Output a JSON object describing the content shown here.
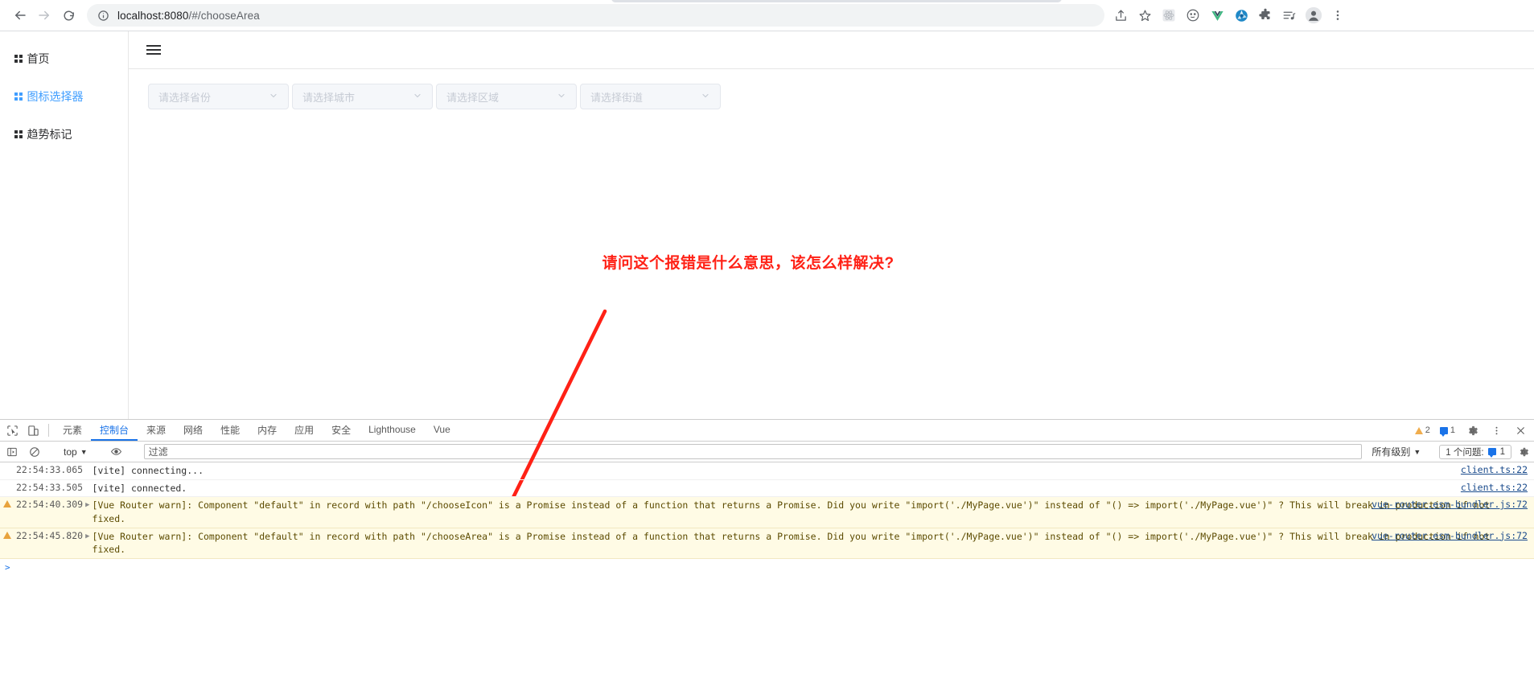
{
  "browser": {
    "back_label": "back-arrow",
    "forward_label": "forward-arrow",
    "reload_label": "reload",
    "url_main": "localhost:8080",
    "url_path": "/#/chooseArea",
    "toolbar_icons": [
      "share-icon",
      "star-icon",
      "react-devtools-icon",
      "emoji-icon",
      "vue-devtools-icon",
      "camera-icon",
      "extensions-icon",
      "playlist-icon",
      "profile-icon",
      "menu-icon"
    ]
  },
  "sidebar": {
    "items": [
      {
        "label": "首页",
        "active": false
      },
      {
        "label": "图标选择器",
        "active": true
      },
      {
        "label": "趋势标记",
        "active": false
      }
    ]
  },
  "main": {
    "selects": [
      {
        "placeholder": "请选择省份"
      },
      {
        "placeholder": "请选择城市"
      },
      {
        "placeholder": "请选择区域"
      },
      {
        "placeholder": "请选择街道"
      }
    ],
    "annotation": "请问这个报错是什么意思，该怎么样解决?",
    "annotation_color": "#ff2116"
  },
  "devtools": {
    "tabs": [
      {
        "label": "元素",
        "active": false
      },
      {
        "label": "控制台",
        "active": true
      },
      {
        "label": "来源",
        "active": false
      },
      {
        "label": "网络",
        "active": false
      },
      {
        "label": "性能",
        "active": false
      },
      {
        "label": "内存",
        "active": false
      },
      {
        "label": "应用",
        "active": false
      },
      {
        "label": "安全",
        "active": false
      },
      {
        "label": "Lighthouse",
        "active": false
      },
      {
        "label": "Vue",
        "active": false
      }
    ],
    "warning_count": "2",
    "message_count": "1",
    "console_bar": {
      "context": "top",
      "filter_placeholder": "过滤",
      "level": "所有级别",
      "issues_text": "1 个问题:",
      "issues_count": "1"
    },
    "logs": [
      {
        "level": "info",
        "time": "22:54:33.065",
        "text": "[vite] connecting...",
        "source": "client.ts:22",
        "expandable": false
      },
      {
        "level": "info",
        "time": "22:54:33.505",
        "text": "[vite] connected.",
        "source": "client.ts:22",
        "expandable": false
      },
      {
        "level": "warn",
        "time": "22:54:40.309",
        "text": "[Vue Router warn]: Component \"default\" in record with path \"/chooseIcon\" is a Promise instead of a function that returns a Promise. Did you write \"import('./MyPage.vue')\" instead of \"() => import('./MyPage.vue')\" ? This will break in production if not fixed.",
        "source": "vue-router.esm-bundler.js:72",
        "expandable": true
      },
      {
        "level": "warn",
        "time": "22:54:45.820",
        "text": "[Vue Router warn]: Component \"default\" in record with path \"/chooseArea\" is a Promise instead of a function that returns a Promise. Did you write \"import('./MyPage.vue')\" instead of \"() => import('./MyPage.vue')\" ? This will break in production if not fixed.",
        "source": "vue-router.esm-bundler.js:72",
        "expandable": true
      }
    ],
    "prompt": ">"
  }
}
